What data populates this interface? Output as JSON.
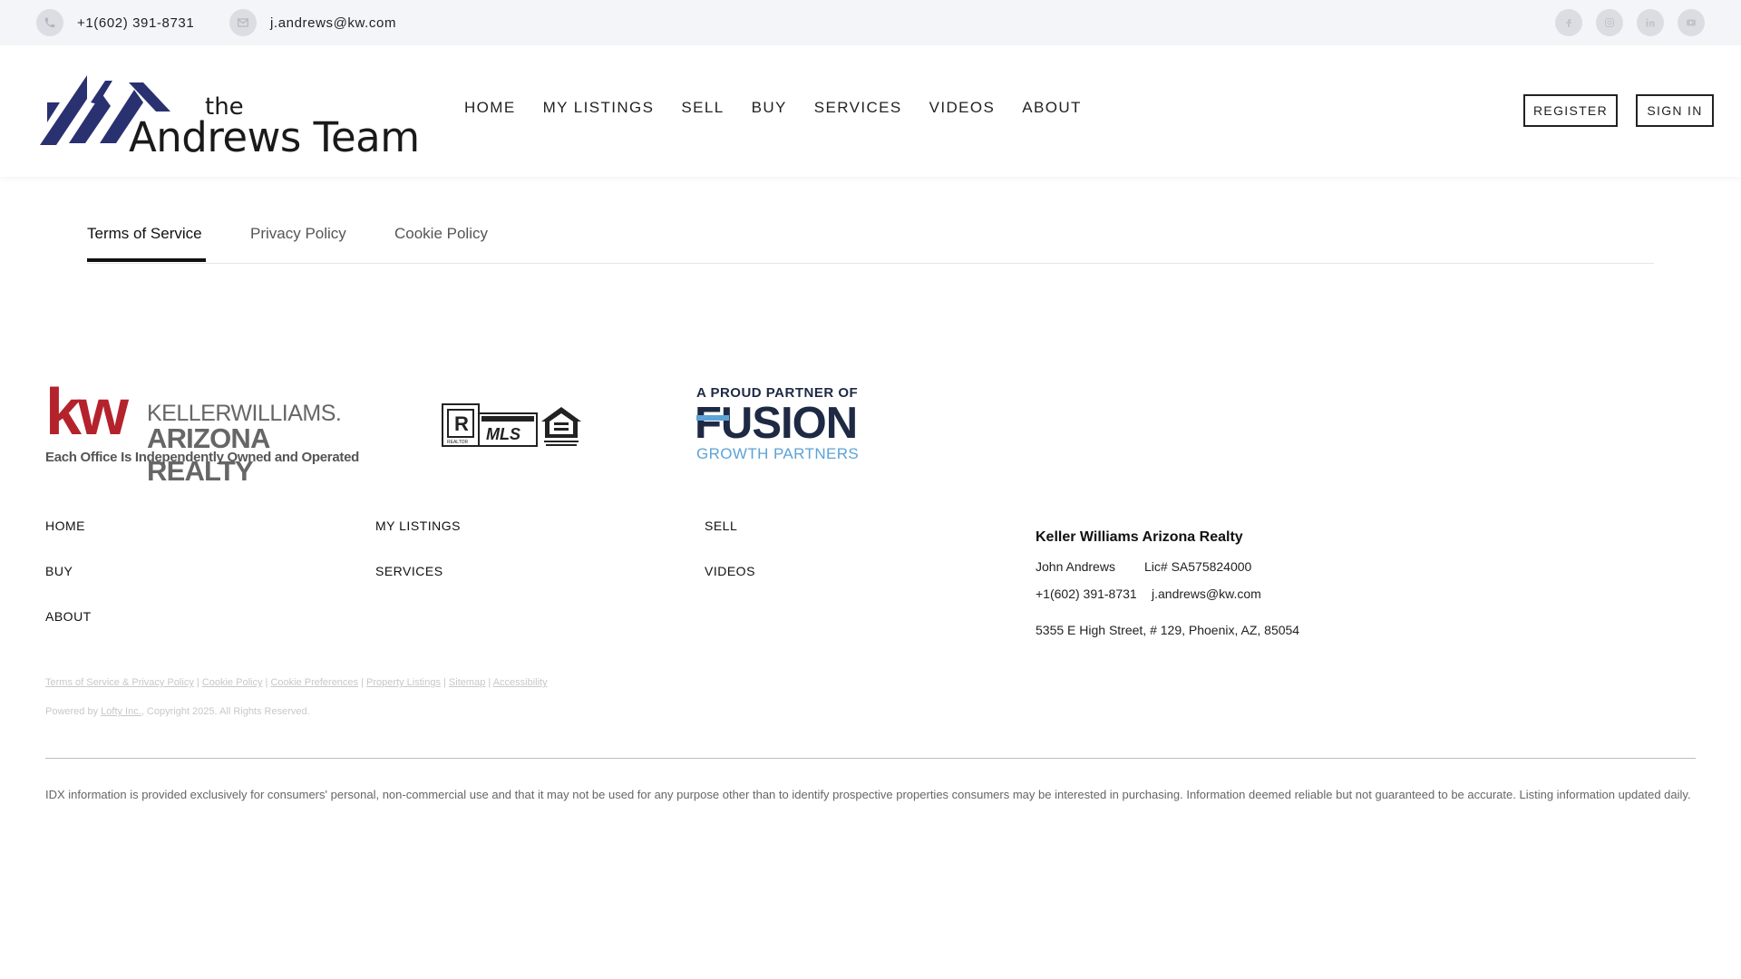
{
  "topbar": {
    "phone": "+1(602) 391-8731",
    "email": "j.andrews@kw.com",
    "phone_icon": "phone-icon",
    "email_icon": "mail-icon",
    "social": [
      {
        "icon": "facebook-icon"
      },
      {
        "icon": "instagram-icon"
      },
      {
        "icon": "linkedin-icon"
      },
      {
        "icon": "youtube-icon"
      }
    ]
  },
  "logo": {
    "the": "the",
    "name": "Andrews Team",
    "color": "#2a3170"
  },
  "nav": {
    "items": [
      "HOME",
      "MY LISTINGS",
      "SELL",
      "BUY",
      "SERVICES",
      "VIDEOS",
      "ABOUT"
    ],
    "register_label": "REGISTER",
    "signin_label": "SIGN IN"
  },
  "tabs": {
    "items": [
      "Terms of Service",
      "Privacy Policy",
      "Cookie Policy"
    ],
    "active": "Terms of Service"
  },
  "partners": {
    "kw": {
      "letters": "kw",
      "name1": "KELLERWILLIAMS.",
      "name2": "ARIZONA REALTY",
      "sub": "Each Office Is Independently Owned and Operated",
      "color": "#b4232c"
    },
    "mls": {
      "realtor": "REALTOR",
      "mls": "MLS"
    },
    "fusion": {
      "top": "A PROUD PARTNER OF",
      "main": "FUSION",
      "sub": "GROWTH PARTNERS",
      "color": "#5da3d6"
    }
  },
  "footer": {
    "nav": [
      "HOME",
      "MY LISTINGS",
      "SELL",
      "BUY",
      "SERVICES",
      "VIDEOS",
      "ABOUT"
    ],
    "agency": {
      "title": "Keller Williams Arizona Realty",
      "agent": "John Andrews",
      "license": "Lic# SA575824000",
      "phone": "+1(602) 391-8731",
      "email": "j.andrews@kw.com",
      "address": "5355 E High Street, # 129, Phoenix, AZ, 85054"
    },
    "legal_links": [
      "Terms of Service & Privacy Policy",
      "Cookie Policy",
      "Cookie Preferences",
      "Property Listings",
      "Sitemap",
      "Accessibility"
    ],
    "powered_prefix": "Powered by",
    "powered_link": "Lofty Inc.",
    "copyright": "Copyright 2025. All Rights Reserved.",
    "idx": "IDX information is provided exclusively for consumers' personal, non-commercial use and that it may not be used for any purpose other than to identify prospective properties consumers may be interested in purchasing. Information deemed reliable but not guaranteed to be accurate. Listing information updated daily."
  }
}
